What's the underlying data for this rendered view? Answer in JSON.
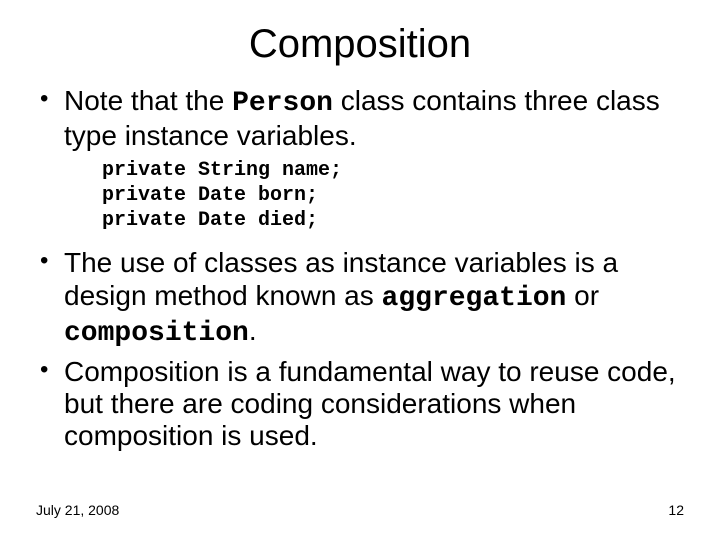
{
  "title": "Composition",
  "bullets": {
    "b1_pre": "Note that the ",
    "b1_mono": "Person",
    "b1_post": " class contains three class type instance variables.",
    "b2_pre": "The use of classes as instance variables is a design method known as ",
    "b2_mono_a": "aggregation",
    "b2_mid": " or ",
    "b2_mono_b": "composition",
    "b2_post": ".",
    "b3": "Composition  is a fundamental way to reuse code, but there are coding considerations when composition is used."
  },
  "code": "private String name;\nprivate Date born;\nprivate Date died;",
  "footer": {
    "date": "July 21, 2008",
    "page": "12"
  }
}
